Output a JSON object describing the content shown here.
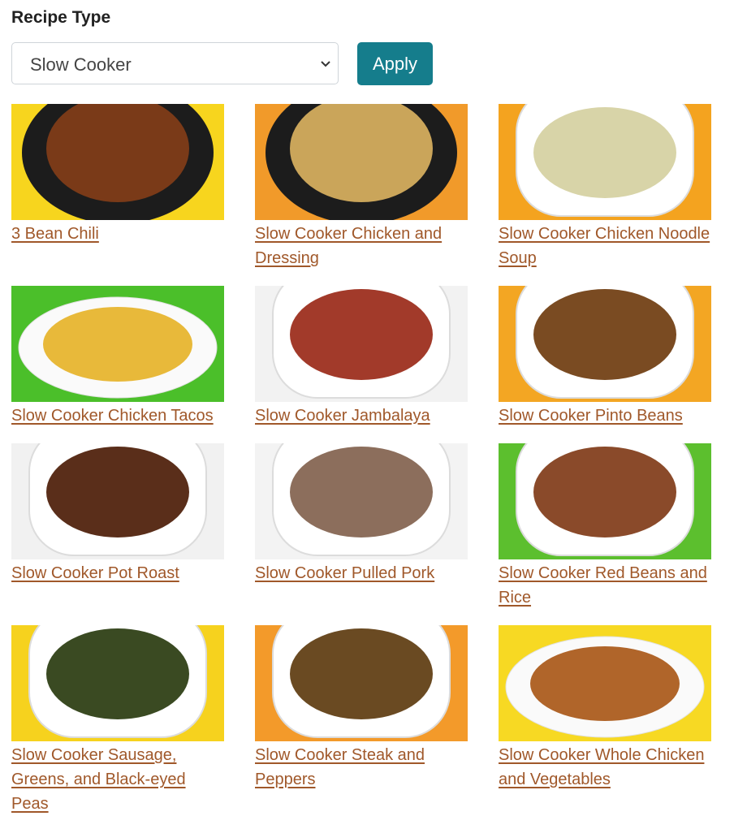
{
  "filter": {
    "label": "Recipe Type",
    "selected": "Slow Cooker",
    "apply_label": "Apply"
  },
  "colors": {
    "button": "#157d8c",
    "link": "#a0582a"
  },
  "recipes": [
    {
      "title": "3 Bean Chili",
      "bg": "#f7d51e",
      "pot": "dark",
      "food": "#7a3a18"
    },
    {
      "title": "Slow Cooker Chicken and Dressing",
      "bg": "#f19a2a",
      "pot": "dark",
      "food": "#caa55a"
    },
    {
      "title": "Slow Cooker Chicken Noodle Soup",
      "bg": "#f4a31f",
      "pot": "white",
      "food": "#d8d4a8"
    },
    {
      "title": "Slow Cooker Chicken Tacos",
      "bg": "#4bbf2a",
      "pot": "platter",
      "food": "#e8b93a"
    },
    {
      "title": "Slow Cooker Jambalaya",
      "bg": "#f2f2f2",
      "pot": "white",
      "food": "#a23a2a"
    },
    {
      "title": "Slow Cooker Pinto Beans",
      "bg": "#f3a623",
      "pot": "white",
      "food": "#7a4b22"
    },
    {
      "title": "Slow Cooker Pot Roast",
      "bg": "#f1f1f1",
      "pot": "white",
      "food": "#5a2e1a"
    },
    {
      "title": "Slow Cooker Pulled Pork",
      "bg": "#f3f3f3",
      "pot": "white",
      "food": "#8c6e5c"
    },
    {
      "title": "Slow Cooker Red Beans and Rice",
      "bg": "#5cbf2e",
      "pot": "white",
      "food": "#8a4a2a"
    },
    {
      "title": "Slow Cooker Sausage, Greens, and Black-eyed Peas",
      "bg": "#f6d21e",
      "pot": "white",
      "food": "#3a4a22"
    },
    {
      "title": "Slow Cooker Steak and Peppers",
      "bg": "#f39a2a",
      "pot": "white",
      "food": "#6a4a22"
    },
    {
      "title": "Slow Cooker Whole Chicken and Vegetables",
      "bg": "#f7d923",
      "pot": "platter",
      "food": "#b0652a"
    }
  ]
}
